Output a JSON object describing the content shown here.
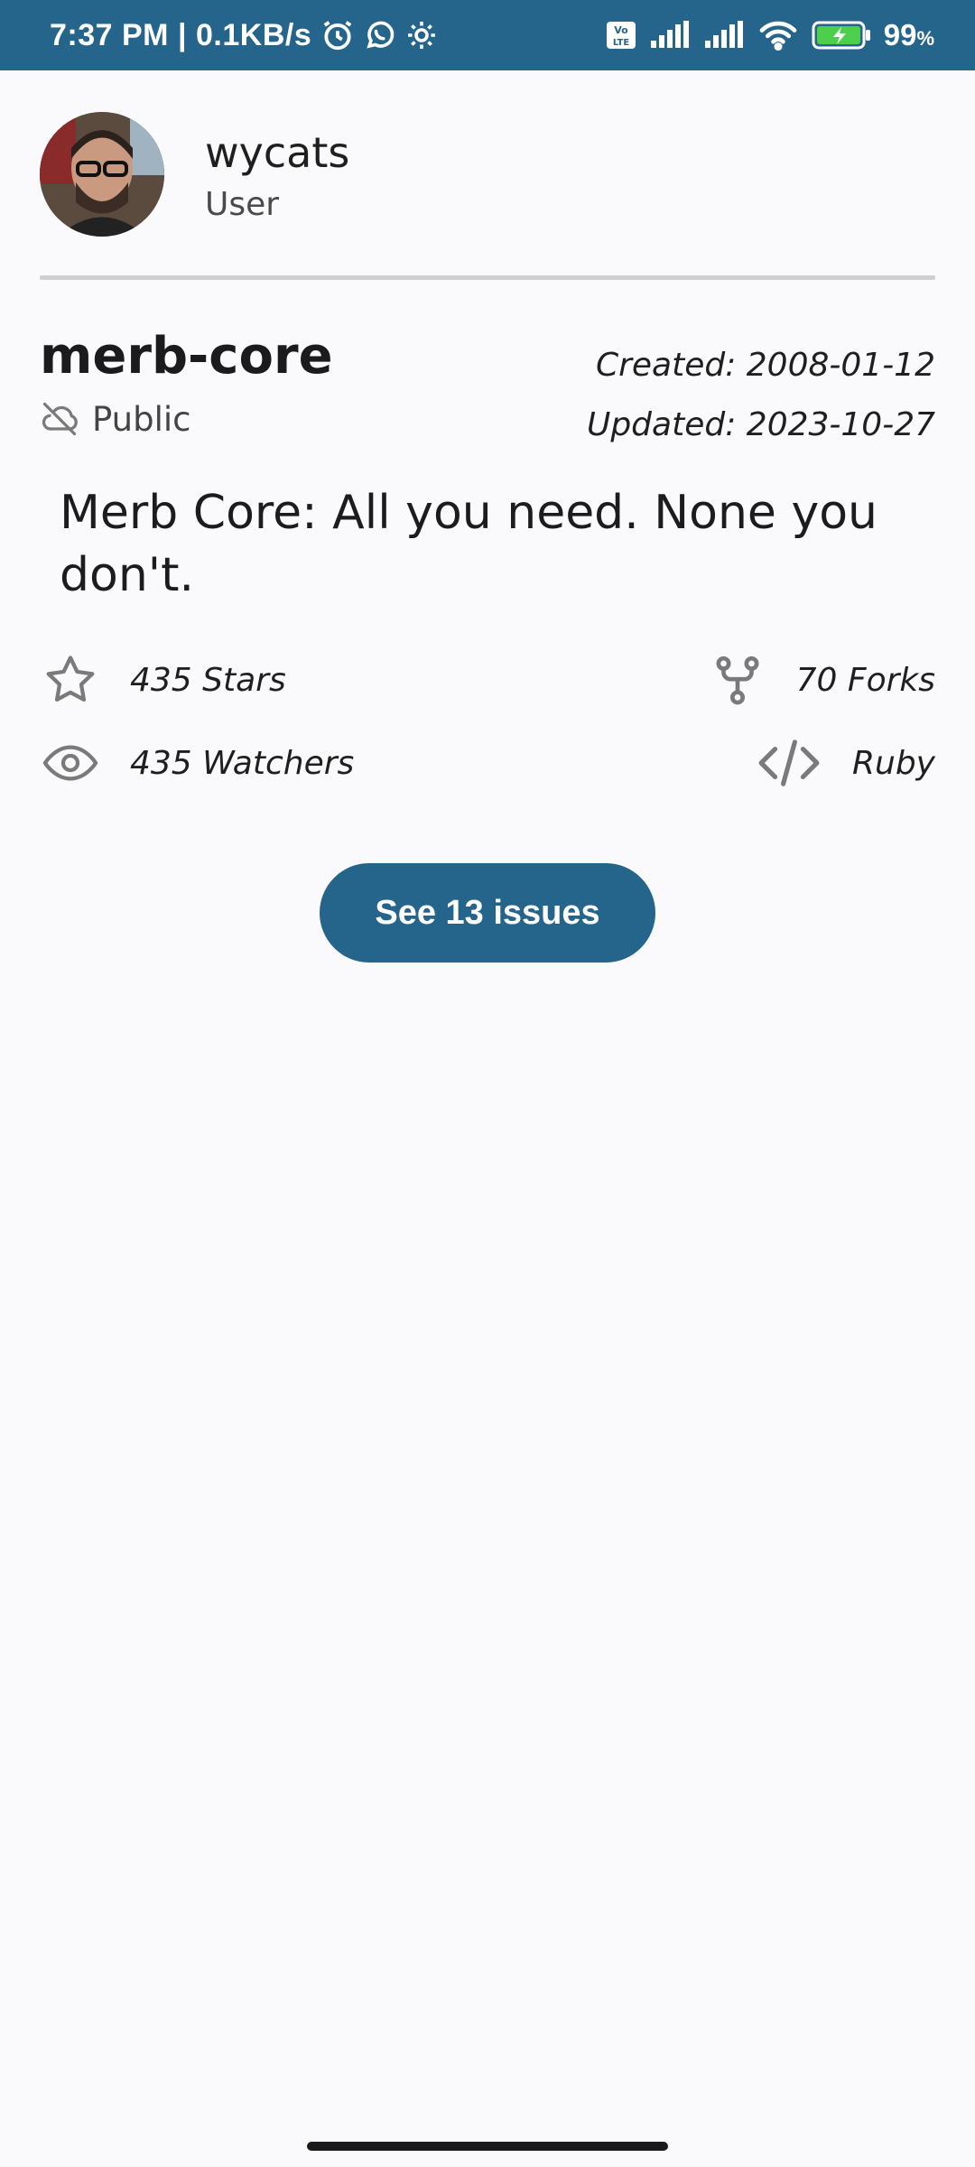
{
  "status_bar": {
    "time": "7:37 PM",
    "separator": "|",
    "speed": "0.1KB/s",
    "battery_level": "99",
    "battery_unit": "%",
    "icons": [
      "alarm-icon",
      "whatsapp-icon",
      "settings-icon",
      "volte-icon",
      "signal-icon",
      "signal-icon",
      "wifi-icon",
      "battery-charging-icon"
    ]
  },
  "owner": {
    "name": "wycats",
    "type": "User"
  },
  "repo": {
    "name": "merb-core",
    "visibility": "Public",
    "created": "Created: 2008-01-12",
    "updated": "Updated: 2023-10-27",
    "description": "Merb Core: All you need. None you don't."
  },
  "stats": {
    "stars": "435 Stars",
    "forks": "70 Forks",
    "watchers": "435 Watchers",
    "language": "Ruby"
  },
  "issues_button": {
    "label": "See 13 issues"
  },
  "colors": {
    "primary": "#26658b",
    "background": "#fafafc",
    "icon_gray": "#7a7a7a"
  }
}
